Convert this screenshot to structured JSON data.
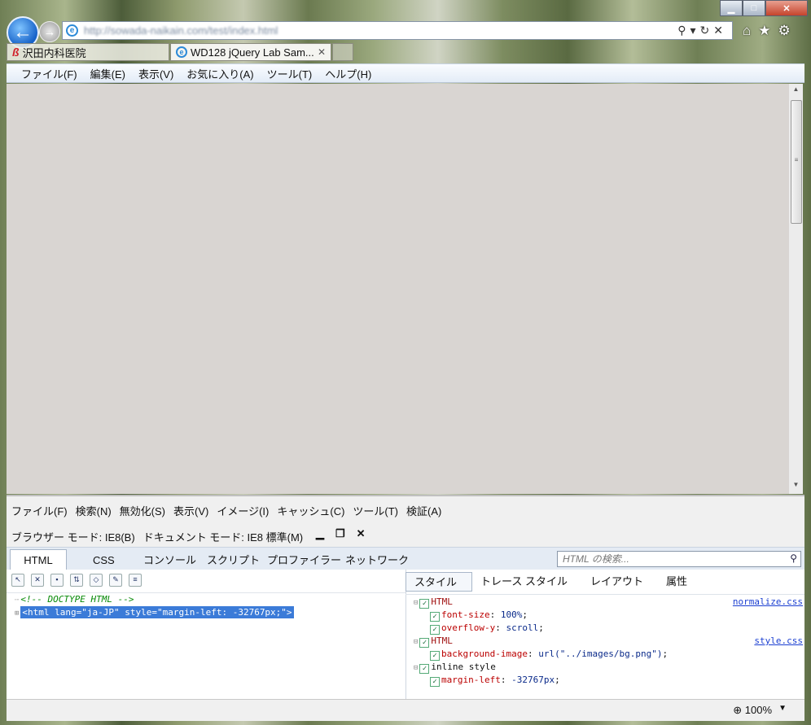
{
  "browser": {
    "url": "http://sowada-naikain.com/test/index.html",
    "tabs": [
      {
        "label": "沢田内科医院",
        "active": false
      },
      {
        "label": "WD128 jQuery Lab Sam...",
        "active": true
      }
    ],
    "menu": [
      "ファイル(F)",
      "編集(E)",
      "表示(V)",
      "お気に入り(A)",
      "ツール(T)",
      "ヘルプ(H)"
    ],
    "content_bg": "#d9d5d2"
  },
  "devtools": {
    "menu": [
      "ファイル(F)",
      "検索(N)",
      "無効化(S)",
      "表示(V)",
      "イメージ(I)",
      "キャッシュ(C)",
      "ツール(T)",
      "検証(A)"
    ],
    "mode": {
      "browser_mode": "ブラウザー モード: IE8(B)",
      "document_mode": "ドキュメント モード: IE8 標準(M)"
    },
    "tabs": [
      "HTML",
      "CSS",
      "コンソール",
      "スクリプト",
      "プロファイラー",
      "ネットワーク"
    ],
    "search_placeholder": "HTML の検索...",
    "tree": {
      "line1": "<!-- DOCTYPE HTML -->",
      "line2": "<html lang=\"ja-JP\" style=\"margin-left: -32767px;\">"
    },
    "style_tabs": [
      "スタイル",
      "トレース スタイル",
      "レイアウト",
      "属性"
    ],
    "rules": [
      {
        "selector": "HTML",
        "source": "normalize.css",
        "props": [
          {
            "name": "font-size",
            "value": "100%"
          },
          {
            "name": "overflow-y",
            "value": "scroll"
          }
        ]
      },
      {
        "selector": "HTML",
        "source": "style.css",
        "props": [
          {
            "name": "background-image",
            "value": "url(\"../images/bg.png\")"
          }
        ]
      },
      {
        "selector": "inline style",
        "source": "",
        "props": [
          {
            "name": "margin-left",
            "value": "-32767px"
          }
        ]
      }
    ]
  },
  "status": {
    "zoom": "100%"
  }
}
